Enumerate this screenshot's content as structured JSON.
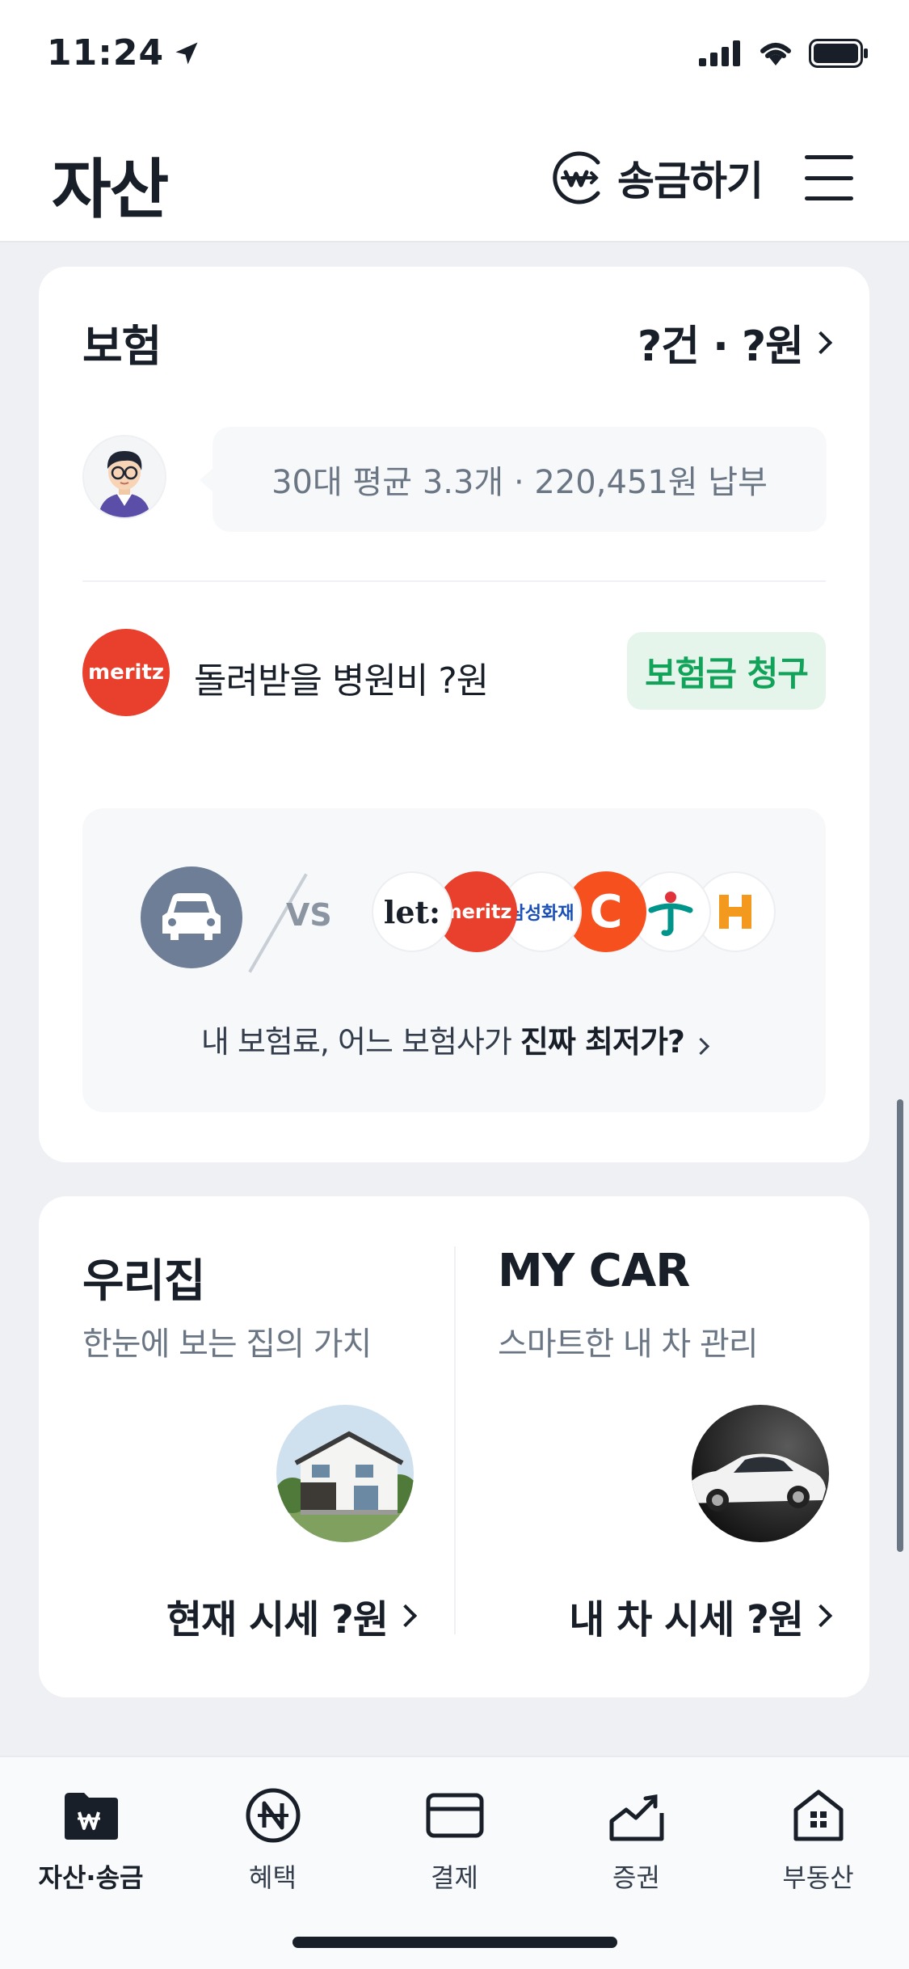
{
  "status_bar": {
    "time": "11:24"
  },
  "header": {
    "title": "자산",
    "send_label": "송금하기"
  },
  "insurance": {
    "title": "보험",
    "summary": "?건 · ?원",
    "average_text": "30대 평균 3.3개 · 220,451원 납부",
    "meritz_logo_text": "meritz",
    "refund_text": "돌려받을 병원비 ?원",
    "claim_button": "보험금 청구",
    "vs_label": "VS",
    "insurer_logos": [
      "let:",
      "meritz",
      "삼성화재",
      "C",
      "하나",
      "H"
    ],
    "compare_prefix": "내 보험료, 어느 보험사가 ",
    "compare_bold": "진짜 최저가?"
  },
  "home": {
    "title": "우리집",
    "subtitle": "한눈에 보는 집의 가치",
    "price_label": "현재 시세 ?원"
  },
  "car": {
    "title": "MY CAR",
    "subtitle": "스마트한 내 차 관리",
    "price_label": "내 차 시세 ?원"
  },
  "tabs": [
    {
      "label": "자산·송금",
      "icon": "wallet-won-icon",
      "active": true
    },
    {
      "label": "혜택",
      "icon": "benefit-coin-icon",
      "active": false
    },
    {
      "label": "결제",
      "icon": "card-icon",
      "active": false
    },
    {
      "label": "증권",
      "icon": "stock-chart-icon",
      "active": false
    },
    {
      "label": "부동산",
      "icon": "house-icon",
      "active": false
    }
  ],
  "colors": {
    "accent_green": "#12a35a",
    "meritz_red": "#e8402d",
    "car_icon_bg": "#6e7e96"
  }
}
